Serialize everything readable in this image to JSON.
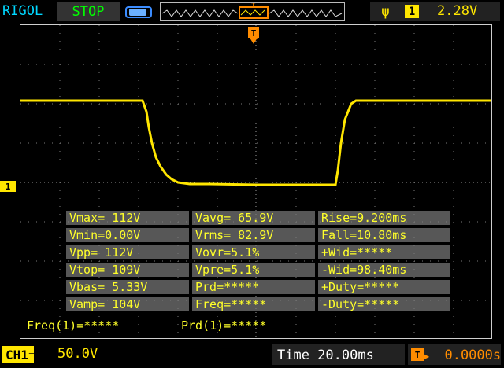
{
  "header": {
    "brand": "RIGOL",
    "run_state": "STOP",
    "trigger": {
      "edge_icon": "rising-edge-icon",
      "channel": "1",
      "level": "2.28V"
    }
  },
  "colors": {
    "trace": "#ffe600",
    "accent": "#00d7ff",
    "stop": "#00ff00",
    "trigger_marker": "#ff8c00"
  },
  "markers": {
    "trigger_position": "T",
    "channel_ground": "1"
  },
  "measurements": [
    [
      "Vmax= 112V",
      "Vavg= 65.9V",
      "Rise=9.200ms"
    ],
    [
      "Vmin=0.00V",
      "Vrms= 82.9V",
      "Fall=10.80ms"
    ],
    [
      "Vpp= 112V",
      "Vovr=5.1%",
      "+Wid=*****"
    ],
    [
      "Vtop= 109V",
      "Vpre=5.1%",
      "-Wid=98.40ms"
    ],
    [
      "Vbas= 5.33V",
      "Prd=*****",
      "+Duty=*****"
    ],
    [
      "Vamp= 104V",
      "Freq=*****",
      "-Duty=*****"
    ]
  ],
  "footer": {
    "freq": "Freq(1)=*****",
    "prd": "Prd(1)=*****",
    "channel_label": "CH1",
    "volts_div": "50.0V",
    "timebase": "Time 20.00ms",
    "trigger_offset": "  0.0000s"
  }
}
